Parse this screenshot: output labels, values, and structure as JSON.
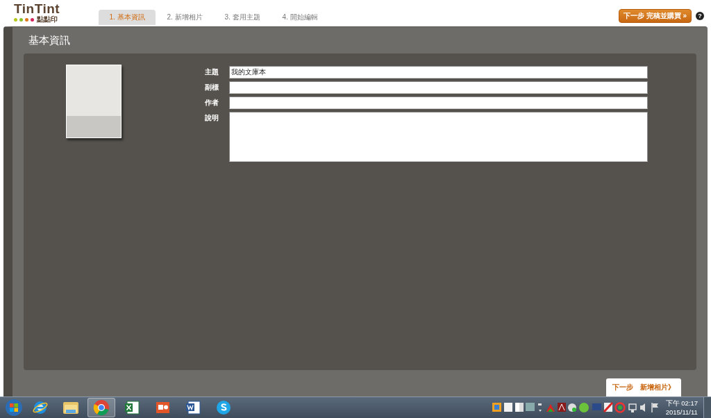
{
  "logo": {
    "name": "TinTint",
    "subtitle": "點點印",
    "dots": [
      {
        "color": "#b5c81e"
      },
      {
        "color": "#8cbf26"
      },
      {
        "color": "#e0761c"
      },
      {
        "color": "#d6245a"
      }
    ]
  },
  "tabs": [
    {
      "label": "1. 基本資訊",
      "selected": true
    },
    {
      "label": "2. 新增相片",
      "selected": false
    },
    {
      "label": "3. 套用主題",
      "selected": false
    },
    {
      "label": "4. 開始編輯",
      "selected": false
    }
  ],
  "finish_button": "下一步 完稿並購買 »",
  "help_button": "?",
  "section_title": "基本資訊",
  "fields": [
    {
      "label": "主題",
      "value": "我的文庫本",
      "kind": "input"
    },
    {
      "label": "副標",
      "kind": "input"
    },
    {
      "label": "作者",
      "kind": "input"
    },
    {
      "label": "說明",
      "kind": "textarea"
    }
  ],
  "next_button": "下一步　新增相片》",
  "taskbar": {
    "apps": [
      {
        "kind": "ie",
        "selected": false
      },
      {
        "kind": "folder",
        "selected": false
      },
      {
        "kind": "chrome",
        "selected": true
      },
      {
        "kind": "excel",
        "selected": false
      },
      {
        "kind": "powerpoint",
        "selected": false
      },
      {
        "kind": "word",
        "selected": false
      },
      {
        "kind": "skype",
        "selected": false
      }
    ],
    "clock": {
      "time": "下午 02:17",
      "date": "2015/11/11"
    }
  }
}
